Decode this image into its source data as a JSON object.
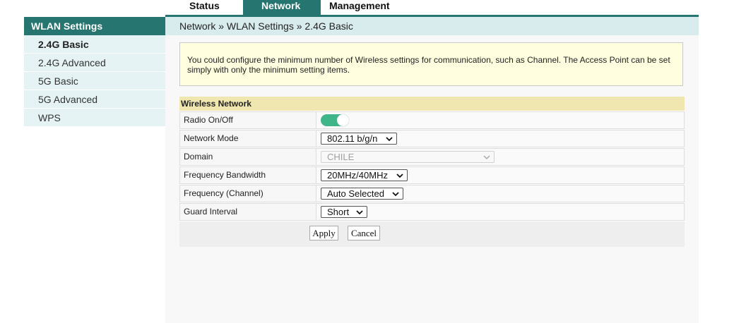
{
  "topnav": {
    "tabs": [
      {
        "label": "Status"
      },
      {
        "label": "Network"
      },
      {
        "label": "Management"
      }
    ]
  },
  "sidebar": {
    "title": "WLAN Settings",
    "items": [
      {
        "label": "2.4G Basic"
      },
      {
        "label": "2.4G Advanced"
      },
      {
        "label": "5G Basic"
      },
      {
        "label": "5G Advanced"
      },
      {
        "label": "WPS"
      }
    ]
  },
  "breadcrumb": "Network » WLAN Settings » 2.4G Basic",
  "info_text": "You could configure the minimum number of Wireless settings for communication, such as Channel. The Access Point can be set simply with only the minimum setting items.",
  "form": {
    "section_title": "Wireless Network",
    "radio_label": "Radio On/Off",
    "radio_state": "on",
    "rows": [
      {
        "label": "Network Mode",
        "value": "802.11 b/g/n"
      },
      {
        "label": "Domain",
        "value": "CHILE"
      },
      {
        "label": "Frequency Bandwidth",
        "value": "20MHz/40MHz"
      },
      {
        "label": "Frequency (Channel)",
        "value": "Auto Selected"
      },
      {
        "label": "Guard Interval",
        "value": "Short"
      }
    ],
    "apply_label": "Apply",
    "cancel_label": "Cancel"
  },
  "colors": {
    "primary": "#267570",
    "sidebar_bg": "#e5f3f4",
    "breadcrumb_bg": "#d9eced",
    "info_bg": "#ffffe0",
    "section_bg": "#f0e6b0",
    "toggle_on": "#3fb58a"
  }
}
